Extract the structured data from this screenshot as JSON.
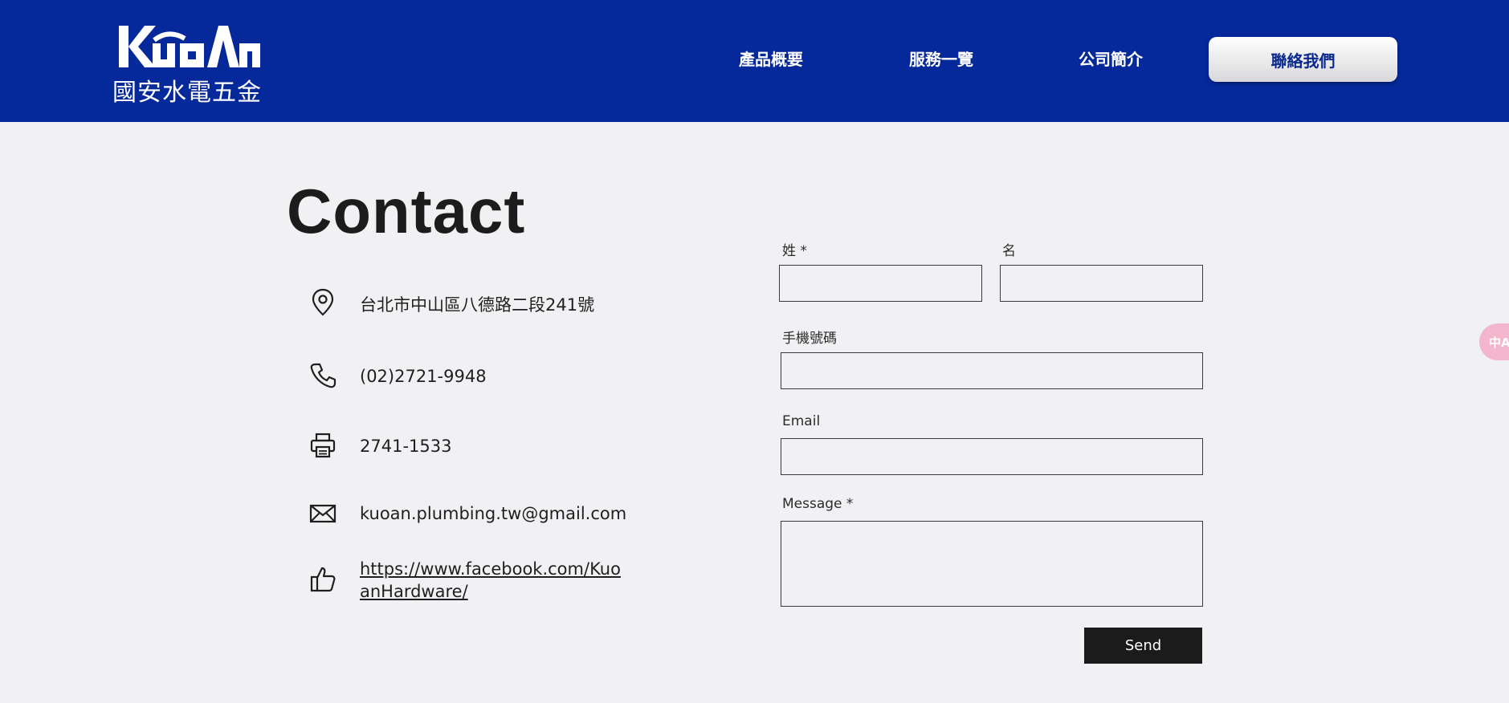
{
  "header": {
    "logo_text": "KuoAn",
    "logo_subtitle": "國安水電五金",
    "nav": [
      {
        "label": "產品概要"
      },
      {
        "label": "服務一覽"
      },
      {
        "label": "公司簡介"
      }
    ],
    "contact_button": "聯絡我們"
  },
  "main": {
    "title": "Contact",
    "info": {
      "address": "台北市中山區八德路二段241號",
      "phone": "(02)2721-9948",
      "fax": "2741-1533",
      "email": "kuoan.plumbing.tw@gmail.com",
      "facebook": "https://www.facebook.com/KuoanHardware/"
    }
  },
  "form": {
    "last_name_label": "姓 *",
    "first_name_label": "名",
    "mobile_label": "手機號碼",
    "email_label": "Email",
    "message_label": "Message *",
    "send_label": "Send"
  },
  "widgets": {
    "translate_label": "中A"
  },
  "colors": {
    "header_bg": "#05289b",
    "page_bg": "#f1f1f3",
    "send_bg": "#1b1b1b"
  }
}
